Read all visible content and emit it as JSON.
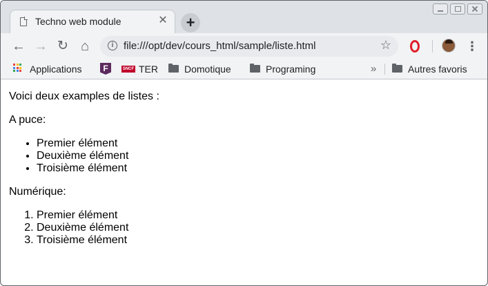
{
  "tab": {
    "title": "Techno web module",
    "close_label": "✕",
    "new_tab_label": "+"
  },
  "toolbar": {
    "url": "file:///opt/dev/cours_html/sample/liste.html",
    "info_glyph": "i",
    "star_glyph": "☆",
    "back_glyph": "←",
    "forward_glyph": "→",
    "reload_glyph": "↻",
    "home_glyph": "⌂",
    "menu_glyph": "⋮"
  },
  "bookmarks": {
    "apps": "Applications",
    "ter": "TER",
    "domotique": "Domotique",
    "programing": "Programing",
    "overflow": "»",
    "autres": "Autres favoris",
    "sncf_badge": "SNCF",
    "f_badge": "F"
  },
  "page": {
    "intro": "Voici deux examples de listes :",
    "bullet_heading": "A puce:",
    "bullet_items": [
      "Premier élément",
      "Deuxième élément",
      "Troisième élément"
    ],
    "numbered_heading": "Numérique:",
    "numbered_items": [
      "Premier élément",
      "Deuxième élément",
      "Troisième élément"
    ]
  },
  "colors": {
    "titlebar": "#dee1e6",
    "toolbar": "#f1f3f4",
    "opera_red": "#e01e2b",
    "sncf_red": "#c1002a"
  },
  "icons": [
    "page-icon",
    "close-icon",
    "plus-icon",
    "back-icon",
    "forward-icon",
    "reload-icon",
    "home-icon",
    "info-icon",
    "star-icon",
    "opera-icon",
    "avatar",
    "menu-icon",
    "apps-icon",
    "folder-icon"
  ]
}
